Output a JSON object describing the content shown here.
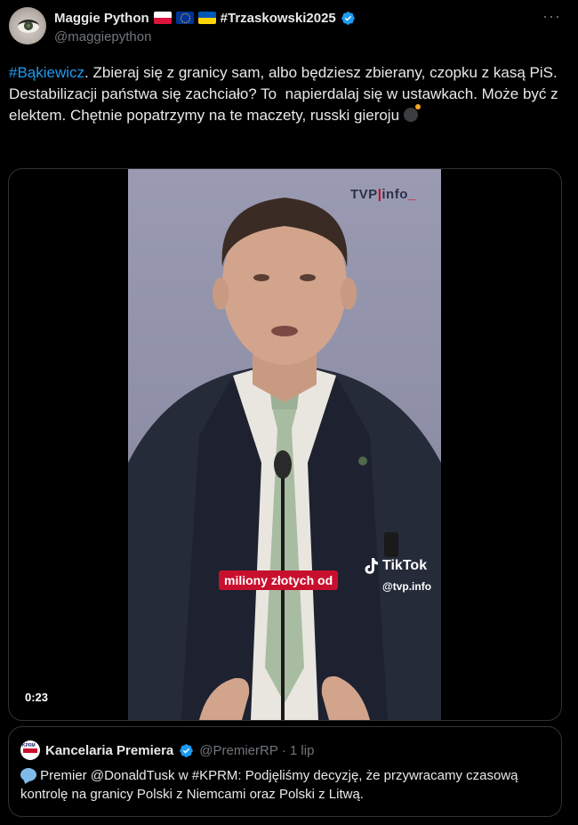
{
  "author": {
    "display_name": "Maggie Python",
    "tag": "#Trzaskowski2025",
    "handle": "@maggiepython"
  },
  "more_label": "···",
  "tweet": {
    "hashtag": "#Bąkiewicz",
    "text": ". Zbieraj się z granicy sam, albo będziesz zbierany, czopku z kasą PiS. Destabilizacji państwa się zachciało? To  napierdalaj się w ustawkach. Może być z elektem. Chętnie popatrzymy na te maczety, russki gieroju "
  },
  "video": {
    "logo_left": "TVP",
    "logo_bar": "|",
    "logo_right": "info",
    "logo_tail": "_",
    "caption": "miliony złotych od",
    "tiktok_label": "TikTok",
    "tiktok_handle": "@tvp.info",
    "duration": "0:23"
  },
  "quote": {
    "name": "Kancelaria Premiera",
    "handle_date": "@PremierRP · 1 lip",
    "text": "Premier @DonaldTusk w #KPRM: Podjęliśmy decyzję, że przywracamy czasową kontrolę na granicy Polski z Niemcami oraz Polski z Litwą."
  },
  "colors": {
    "accent": "#1d9bf0",
    "background": "#000000",
    "text": "#e7e9ea",
    "muted": "#71767b",
    "caption_red": "#c8102e"
  }
}
